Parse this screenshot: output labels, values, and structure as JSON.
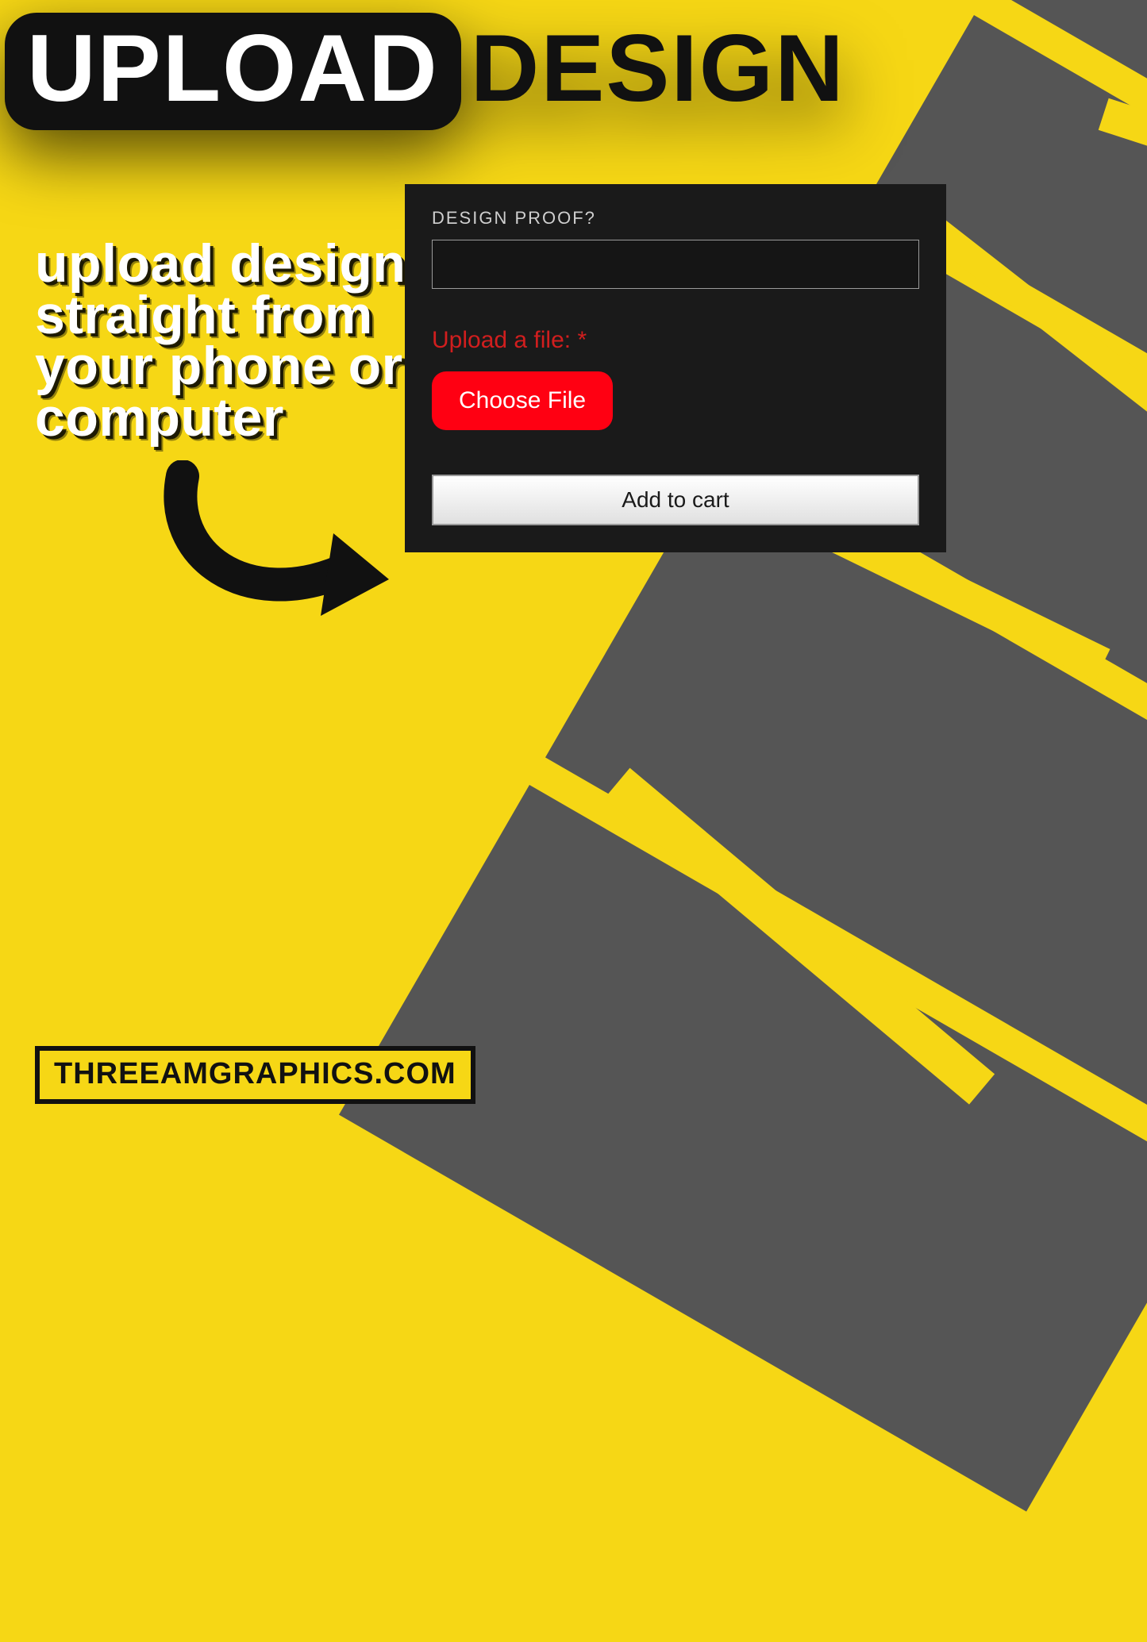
{
  "heading": {
    "pill": "UPLOAD",
    "design": "DESIGN"
  },
  "copy": "upload design straight from your phone or computer",
  "panel": {
    "designproof_label": "DESIGN PROOF?",
    "designproof_value": "",
    "upload_label": "Upload a file:",
    "required_mark": "*",
    "choose_file": "Choose File",
    "add_to_cart": "Add to cart"
  },
  "footer": {
    "site": "THREEAMGRAPHICS.COM"
  },
  "colors": {
    "yellow": "#f6d715",
    "black": "#111111",
    "panel": "#1a1a1a",
    "grey": "#555555",
    "red": "#ff0012"
  }
}
